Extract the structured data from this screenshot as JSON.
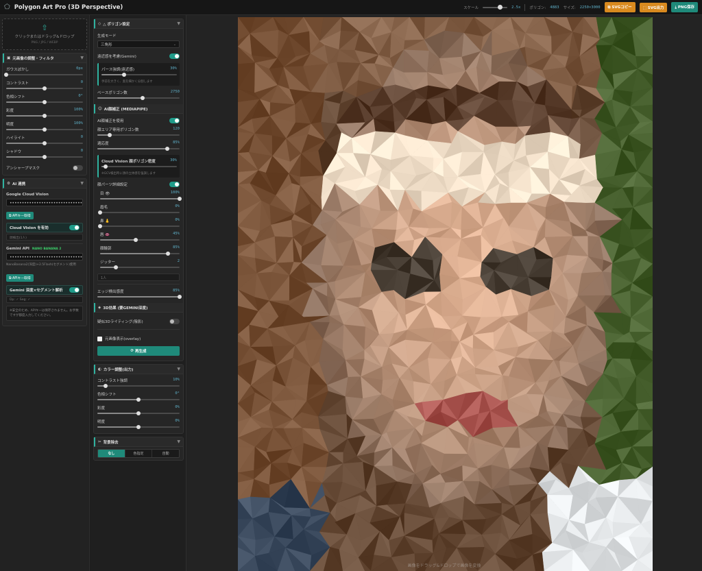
{
  "app": {
    "title": "Polygon Art Pro (3D Perspective)"
  },
  "topbar": {
    "scale_label": "スケール",
    "scale_value": "2.5x",
    "scale_fraction": 0.6,
    "polygons_label": "ポリゴン:",
    "polygons_value": "4883",
    "size_label": "サイズ:",
    "size_value": "2250×3000",
    "svg_copy": "SVGコピー",
    "svg_export": "SVG出力",
    "png_save": "PNG保存"
  },
  "upload": {
    "text": "クリックまたはドラッグ&ドロップ",
    "formats": "PNG / JPG / WEBP"
  },
  "filter_panel": {
    "title": "元画像の調整・フィルタ",
    "sliders": [
      {
        "label": "ガウスぼかし",
        "value": "0px",
        "pct": 0
      },
      {
        "label": "コントラスト",
        "value": "0",
        "pct": 50
      },
      {
        "label": "色相シフト",
        "value": "0°",
        "pct": 50
      },
      {
        "label": "彩度",
        "value": "100%",
        "pct": 50
      },
      {
        "label": "明度",
        "value": "100%",
        "pct": 50
      },
      {
        "label": "ハイライト",
        "value": "0",
        "pct": 50
      },
      {
        "label": "シャドウ",
        "value": "0",
        "pct": 50
      }
    ],
    "unsharp": "アンシャープマスク"
  },
  "ai_panel": {
    "title": "AI 連携",
    "gcv_label": "Google Cloud Vision",
    "gcv_key": "••••••••••••••••••••••••••••••••••••••",
    "get_key": "APIキー取得",
    "cv_toggle": "Cloud Vision を有効",
    "cv_status": "顔検出(1人)",
    "gemini_label": "Gemini API",
    "gemini_badge": "NANO BANANA 2",
    "gemini_key": "••••••••••••••••••••••••••••••••••••••",
    "gemini_note": "NanoBanana2(深度)+2.5Flash(セグメント)使用",
    "get_key2": "APIキー取得",
    "gemini_toggle": "Gemini 深度×セグメント解析",
    "gemini_status": "Dp: ✓  Seg: ✓",
    "warning": "※安全のため、APIキーは保存されません。お手数ですが都度入力してください。"
  },
  "polygon_panel": {
    "title": "△ ポリゴン設定",
    "mode_label": "生成モード",
    "mode_value": "三角形",
    "perspective_label": "遠近感を考慮(Gemini)",
    "perspective_strength_label": "パース強調(遠近感)",
    "perspective_strength_value": "30%",
    "perspective_strength_pct": 30,
    "perspective_note": "手前を大きく、奥を細かく分割します",
    "base_label": "ベースポリゴン数",
    "base_value": "2750",
    "base_pct": 55
  },
  "face_panel": {
    "title": "AI顔補正 (MEDIAPIPE)",
    "use_label": "AI顔補正を使用",
    "face_poly_label": "顔エリア専用ポリゴン数",
    "face_poly_value": "120",
    "face_poly_pct": 15,
    "fit_label": "適応度",
    "fit_value": "85%",
    "fit_pct": 85,
    "cv_density_label": "Cloud Vision 顔ポリゴン密度",
    "cv_density_value": "30%",
    "cv_density_pct": 5,
    "cv_note": "※GCV検出時に顔の立体感を強調します",
    "detail_label": "顔パーツ詳細設定",
    "parts": [
      {
        "label": "目 👁",
        "value": "100%",
        "pct": 100
      },
      {
        "label": "眉毛",
        "value": "0%",
        "pct": 0
      },
      {
        "label": "鼻 👃",
        "value": "0%",
        "pct": 0
      },
      {
        "label": "唇 👄",
        "value": "45%",
        "pct": 45
      },
      {
        "label": "顔輪郭",
        "value": "85%",
        "pct": 85
      },
      {
        "label": "ジッター",
        "value": "2",
        "pct": 20
      }
    ],
    "hint": "1人",
    "edge_label": "エッジ検出感度",
    "edge_value": "85%",
    "edge_pct": 100
  },
  "effect_panel": {
    "title": "3D効果 (要GEMINI深度)",
    "lighting_label": "疑似3Dライティング(陰影)",
    "overlay_label": "元画像表示(overlay)",
    "regen": "再生成"
  },
  "color_panel": {
    "title": "カラー調整(出力)",
    "sliders": [
      {
        "label": "コントラスト強調",
        "value": "10%",
        "pct": 10
      },
      {
        "label": "色相シフト",
        "value": "0°",
        "pct": 50
      },
      {
        "label": "彩度",
        "value": "0%",
        "pct": 50
      },
      {
        "label": "明度",
        "value": "0%",
        "pct": 50
      }
    ]
  },
  "bg_panel": {
    "title": "背景除去",
    "options": [
      "なし",
      "色指定",
      "自動"
    ],
    "selected": 0
  },
  "canvas": {
    "caption": "画像をドラッグ&ドロップで画像を変換"
  }
}
